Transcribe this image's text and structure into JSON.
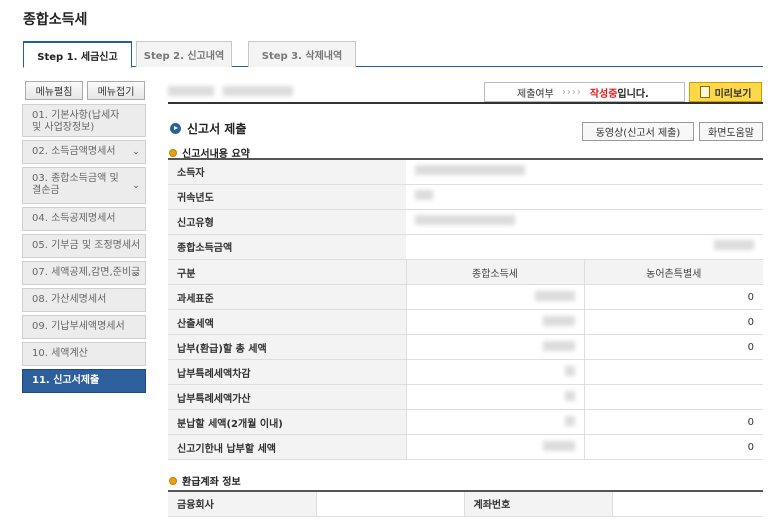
{
  "page": {
    "title": "종합소득세"
  },
  "tabs": [
    {
      "label": "Step 1. 세금신고",
      "active": true
    },
    {
      "label": "Step 2. 신고내역",
      "active": false
    },
    {
      "label": "Step 3. 삭제내역",
      "active": false
    }
  ],
  "sidebar": {
    "expand_label": "메뉴펼침",
    "collapse_label": "메뉴접기",
    "items": [
      {
        "label": "01. 기본사항(납세자 및 사업장정보)"
      },
      {
        "label": "02. 소득금액명세서"
      },
      {
        "label": "03. 종합소득금액 및 결손금"
      },
      {
        "label": "04. 소득공제명세서"
      },
      {
        "label": "05. 기부금 및 조정명세서"
      },
      {
        "label": "07. 세액공제,감면,준비금"
      },
      {
        "label": "08. 가산세명세서"
      },
      {
        "label": "09. 기납부세액명세서"
      },
      {
        "label": "10. 세액계산"
      },
      {
        "label": "11. 신고서제출"
      }
    ]
  },
  "status": {
    "prefix": "제출여부",
    "arrows": "››››",
    "state": "작성중",
    "suffix": "입니다."
  },
  "buttons": {
    "preview": "미리보기",
    "video": "동영상(신고서 제출)",
    "help": "화면도움말"
  },
  "section": {
    "title": "신고서 제출"
  },
  "summary": {
    "title": "신고서내용 요약",
    "rows": [
      "소득자",
      "귀속년도",
      "신고유형",
      "종합소득금액"
    ]
  },
  "calc": {
    "col_label": "구분",
    "col_income": "종합소득세",
    "col_rural": "농어촌특별세",
    "rows": [
      {
        "label": "과세표준",
        "rural": "0"
      },
      {
        "label": "산출세액",
        "rural": "0"
      },
      {
        "label": "납부(환급)할 총 세액",
        "rural": "0"
      },
      {
        "label": "납부특례세액차감",
        "rural": ""
      },
      {
        "label": "납부특례세액가산",
        "rural": ""
      },
      {
        "label": "분납할 세액(2개월 이내)",
        "rural": "0"
      },
      {
        "label": "신고기한내 납부할 세액",
        "rural": "0"
      }
    ]
  },
  "refund": {
    "title": "환급계좌 정보",
    "bank_label": "금융회사",
    "account_label": "계좌번호"
  }
}
